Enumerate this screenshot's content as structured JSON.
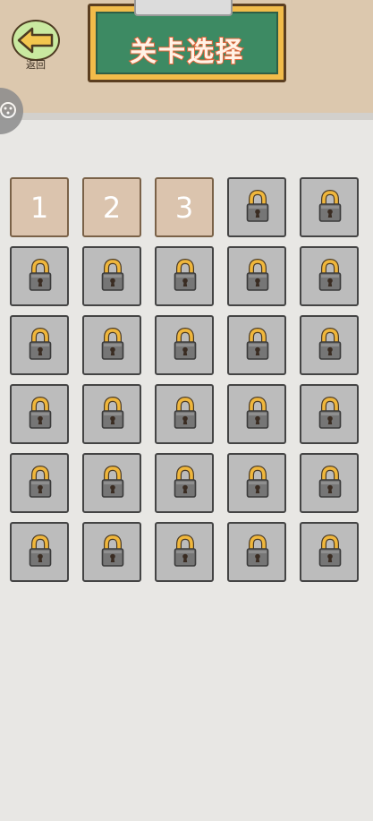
{
  "header": {
    "back_label": "返回",
    "title": "关卡选择"
  },
  "levels": [
    {
      "label": "1",
      "locked": false
    },
    {
      "label": "2",
      "locked": false
    },
    {
      "label": "3",
      "locked": false
    },
    {
      "label": "",
      "locked": true
    },
    {
      "label": "",
      "locked": true
    },
    {
      "label": "",
      "locked": true
    },
    {
      "label": "",
      "locked": true
    },
    {
      "label": "",
      "locked": true
    },
    {
      "label": "",
      "locked": true
    },
    {
      "label": "",
      "locked": true
    },
    {
      "label": "",
      "locked": true
    },
    {
      "label": "",
      "locked": true
    },
    {
      "label": "",
      "locked": true
    },
    {
      "label": "",
      "locked": true
    },
    {
      "label": "",
      "locked": true
    },
    {
      "label": "",
      "locked": true
    },
    {
      "label": "",
      "locked": true
    },
    {
      "label": "",
      "locked": true
    },
    {
      "label": "",
      "locked": true
    },
    {
      "label": "",
      "locked": true
    },
    {
      "label": "",
      "locked": true
    },
    {
      "label": "",
      "locked": true
    },
    {
      "label": "",
      "locked": true
    },
    {
      "label": "",
      "locked": true
    },
    {
      "label": "",
      "locked": true
    },
    {
      "label": "",
      "locked": true
    },
    {
      "label": "",
      "locked": true
    },
    {
      "label": "",
      "locked": true
    },
    {
      "label": "",
      "locked": true
    },
    {
      "label": "",
      "locked": true
    }
  ],
  "icons": {
    "back": "arrow-left-icon",
    "lock": "padlock-icon",
    "float_handle": "gamepad-icon"
  },
  "colors": {
    "header_bg": "#dcc8ae",
    "page_bg": "#e8e7e4",
    "chalkboard": "#3d8a63",
    "board_frame": "#f2bc4a",
    "title_outline": "#e2683e",
    "unlocked_tile": "#dbc4ae",
    "locked_tile": "#bcbcbc",
    "lock_shackle": "#f0b73c",
    "back_button": "#c9e9a0",
    "back_arrow": "#f3c64e"
  }
}
